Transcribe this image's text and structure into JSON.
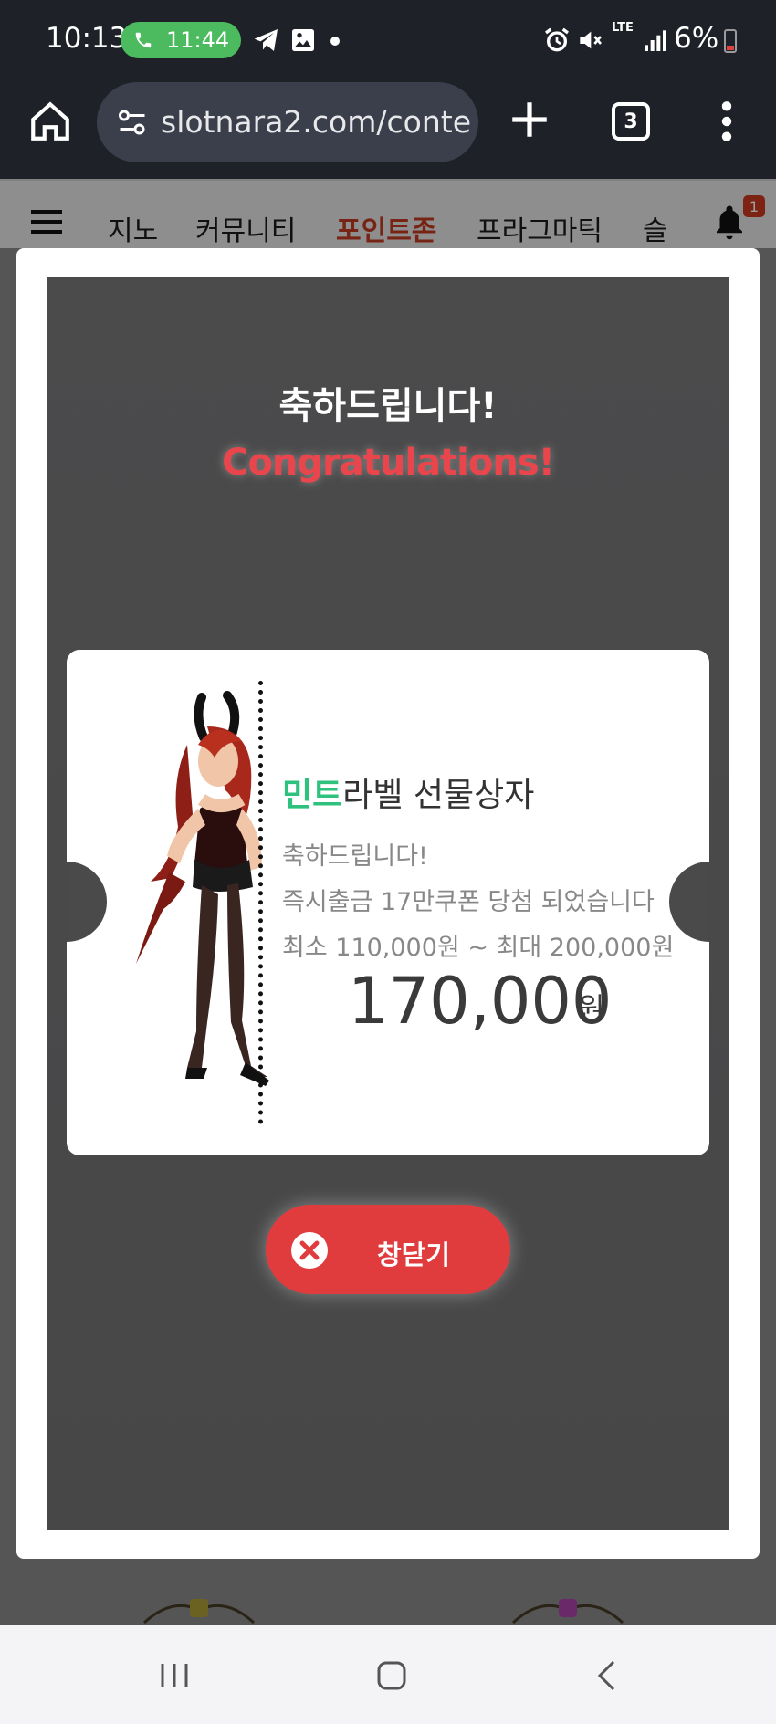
{
  "status_bar": {
    "time": "10:13",
    "call_timer": "11:44",
    "network": "LTE",
    "battery": "6%",
    "icons": [
      "phone-icon",
      "telegram-icon",
      "gallery-icon",
      "alarm-icon",
      "mute-icon",
      "signal-icon",
      "battery-icon"
    ]
  },
  "browser": {
    "url": "slotnara2.com/conte",
    "tab_count": "3"
  },
  "site_nav": {
    "items": [
      {
        "label": "지노",
        "active": false
      },
      {
        "label": "커뮤니티",
        "active": false
      },
      {
        "label": "포인트존",
        "active": true
      },
      {
        "label": "프라그마틱",
        "active": false
      },
      {
        "label": "슬",
        "active": false
      }
    ],
    "notification_count": "1",
    "active_color": "#c23b22"
  },
  "popup": {
    "title_ko": "축하드립니다!",
    "title_en": "Congratulations!",
    "prize": {
      "name_accent": "민트",
      "name_rest": "라벨 선물상자",
      "line1": "축하드립니다!",
      "line2": "즉시출금 17만쿠폰 당첨 되었습니다",
      "line3": "최소 110,000원 ~ 최대 200,000원",
      "amount": "170,000",
      "unit": "원",
      "accent_color": "#2ec27e"
    },
    "close_label": "창닫기",
    "close_color": "#e03c3e"
  }
}
